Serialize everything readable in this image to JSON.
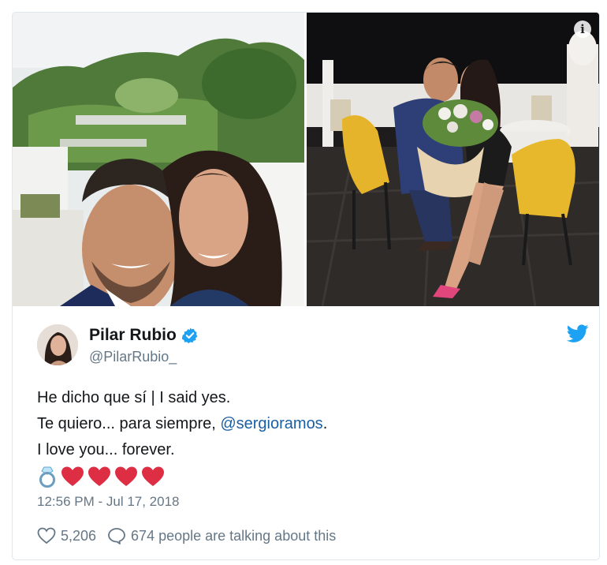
{
  "tweet": {
    "display_name": "Pilar Rubio",
    "handle": "@PilarRubio_",
    "verified": true,
    "text_line_1": "He dicho que sí | I said yes.",
    "text_line_2_prefix": "Te quiero... para siempre, ",
    "mention": "@sergioramos",
    "text_line_2_suffix": ".",
    "text_line_3": "I love you... forever.",
    "emojis": [
      "ring",
      "heart",
      "heart",
      "heart",
      "heart"
    ],
    "timestamp": "12:56 PM - Jul 17, 2018",
    "likes": "5,206",
    "conversation": "674 people are talking about this"
  },
  "media": {
    "photos": [
      {
        "name": "selfie-photo",
        "icon": "photo"
      },
      {
        "name": "proposal-photo",
        "icon": "photo"
      }
    ],
    "info_icon": "i"
  },
  "colors": {
    "link": "#1b5fa3",
    "twitter_blue": "#1da1f2",
    "heart_red": "#dd2e44",
    "secondary_text": "#657786"
  }
}
